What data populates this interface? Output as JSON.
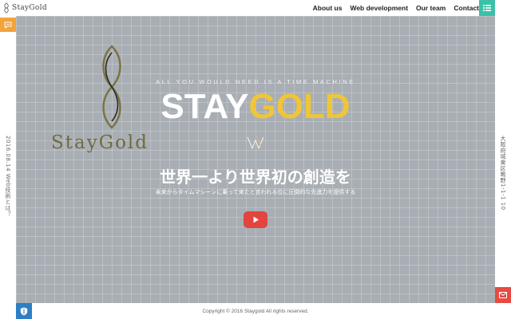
{
  "header": {
    "brand": "StayGold",
    "nav": [
      "About us",
      "Web development",
      "Our team",
      "Contact"
    ],
    "menu_icon": "list-icon"
  },
  "left_rail": {
    "chat_icon": "chat-icon",
    "vertical_text": "2016.08.14 Web技術とは？",
    "shield_icon": "shield-icon"
  },
  "right_rail": {
    "vertical_text": "大阪府城東区鴫野1-1-1 10",
    "mail_icon": "mail-icon"
  },
  "hero": {
    "logo_word": "StayGold",
    "tagline": "ALL YOU WOULD NEED IS A TIME MACHINE",
    "title_white": "STAY",
    "title_gold": "GOLD",
    "headline": "世界一より世界初の創造を",
    "sub": "未来からタイムマシーンに乗って来たと言われる位に圧倒的な先進力を提供する",
    "play_icon": "play-icon"
  },
  "footer": {
    "copyright": "Copyright © 2016 Staygold All rights reserved."
  },
  "colors": {
    "accent_teal": "#3cc0a7",
    "accent_orange": "#f2a33a",
    "accent_red": "#e54b42",
    "accent_blue": "#2d7ec4",
    "gold": "#f0c537",
    "hero_bg": "#a8aeb3"
  }
}
